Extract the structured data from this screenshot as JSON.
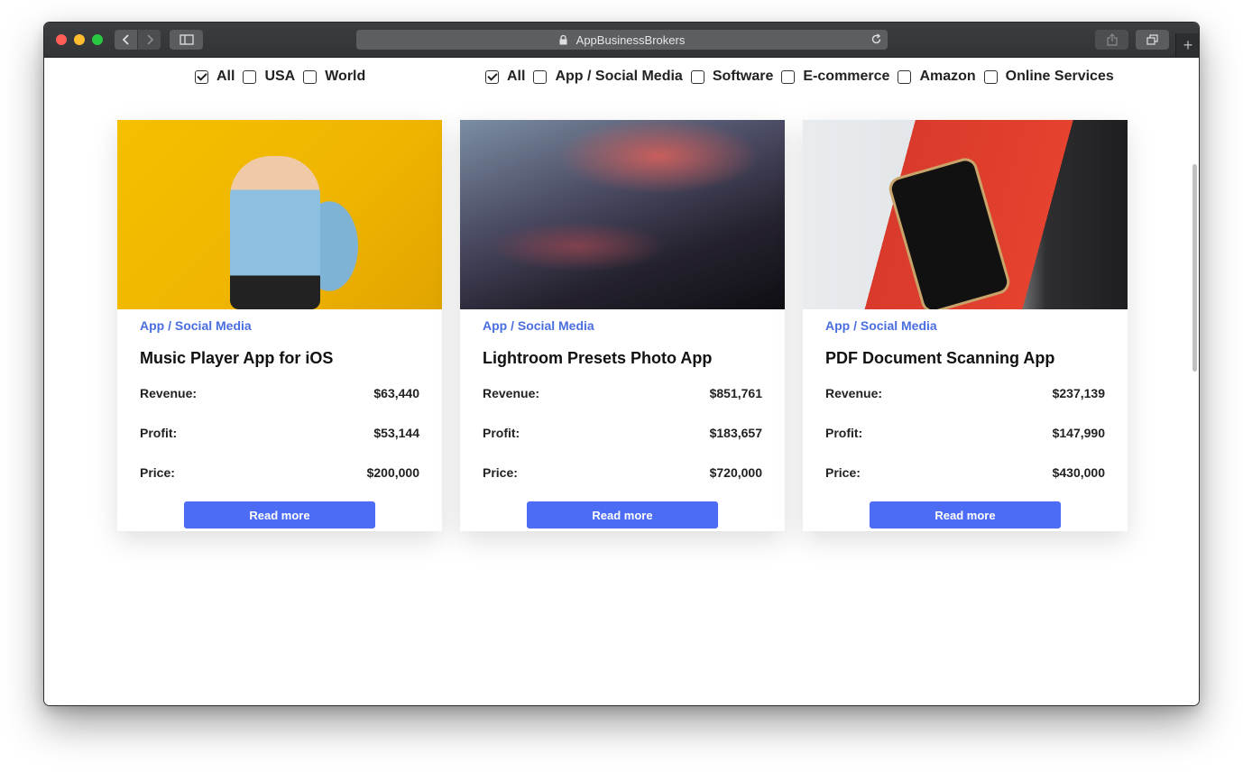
{
  "browser": {
    "url_text": "AppBusinessBrokers",
    "icons": [
      "back-icon",
      "forward-icon",
      "sidebar-icon",
      "lock-icon",
      "reload-icon",
      "share-icon",
      "tabs-icon",
      "plus-icon"
    ]
  },
  "filters": {
    "region": [
      {
        "label": "All",
        "checked": true
      },
      {
        "label": "USA",
        "checked": false
      },
      {
        "label": "World",
        "checked": false
      }
    ],
    "category": [
      {
        "label": "All",
        "checked": true
      },
      {
        "label": "App / Social Media",
        "checked": false
      },
      {
        "label": "Software",
        "checked": false
      },
      {
        "label": "E-commerce",
        "checked": false
      },
      {
        "label": "Amazon",
        "checked": false
      },
      {
        "label": "Online Services",
        "checked": false
      }
    ]
  },
  "stat_labels": {
    "revenue": "Revenue:",
    "profit": "Profit:",
    "price": "Price:"
  },
  "listings": [
    {
      "category": "App / Social Media",
      "title": "Music Player App for iOS",
      "revenue": "$63,440",
      "profit": "$53,144",
      "price": "$200,000",
      "button": "Read more"
    },
    {
      "category": "App / Social Media",
      "title": "Lightroom Presets Photo App",
      "revenue": "$851,761",
      "profit": "$183,657",
      "price": "$720,000",
      "button": "Read more"
    },
    {
      "category": "App / Social Media",
      "title": "PDF Document Scanning App",
      "revenue": "$237,139",
      "profit": "$147,990",
      "price": "$430,000",
      "button": "Read more"
    }
  ],
  "colors": {
    "accent": "#4c6cf5",
    "category": "#4a6ee0"
  }
}
